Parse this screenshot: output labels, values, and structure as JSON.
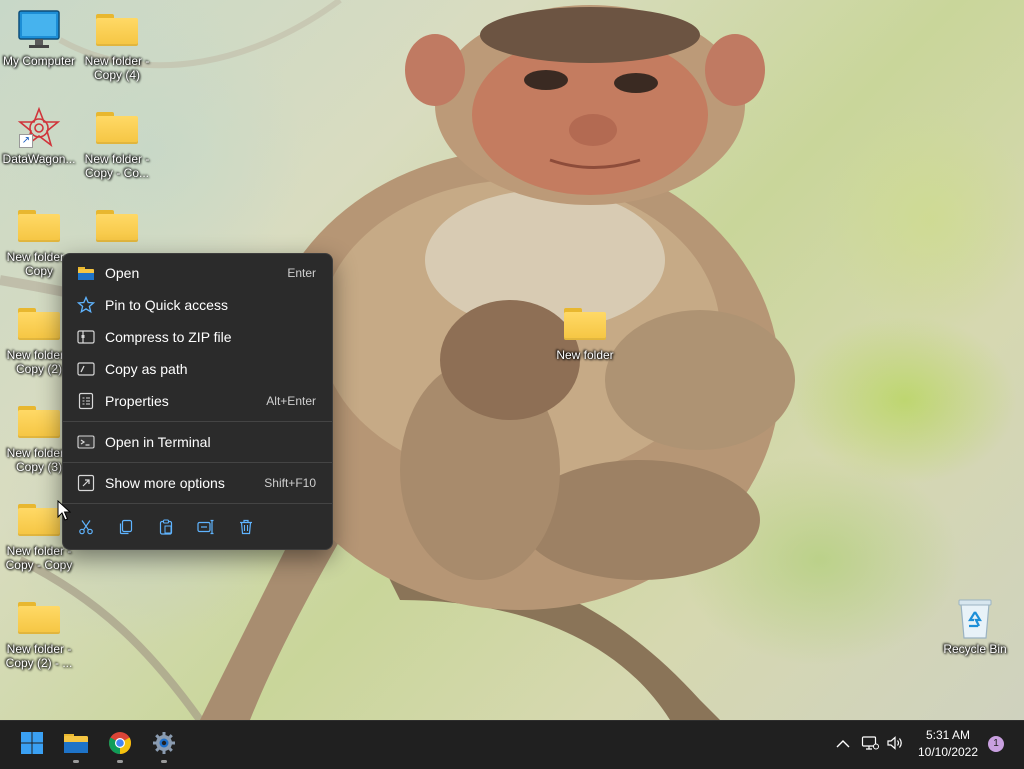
{
  "desktop": {
    "icons": [
      {
        "label": "My Computer",
        "icon": "monitor-icon"
      },
      {
        "label": "New folder - Copy (4)",
        "icon": "folder-icon"
      },
      {
        "label": "DataWagon...",
        "icon": "datawagon-shortcut-icon"
      },
      {
        "label": "New folder - Copy - Co...",
        "icon": "folder-icon"
      },
      {
        "label": "New folder - Copy",
        "icon": "folder-icon"
      },
      {
        "label": "",
        "icon": "folder-icon"
      },
      {
        "label": "New folder - Copy (2)",
        "icon": "folder-icon"
      },
      {
        "label": "New folder - Copy (3)",
        "icon": "folder-icon"
      },
      {
        "label": "New folder - Copy - Copy",
        "icon": "folder-icon"
      },
      {
        "label": "New folder - Copy (2) - ...",
        "icon": "folder-icon"
      },
      {
        "label": "New folder",
        "icon": "folder-icon"
      },
      {
        "label": "Recycle Bin",
        "icon": "recycle-bin-icon"
      }
    ]
  },
  "context_menu": {
    "items": [
      {
        "label": "Open",
        "shortcut": "Enter",
        "icon": "folder-open-icon"
      },
      {
        "label": "Pin to Quick access",
        "shortcut": "",
        "icon": "star-icon"
      },
      {
        "label": "Compress to ZIP file",
        "shortcut": "",
        "icon": "zip-icon"
      },
      {
        "label": "Copy as path",
        "shortcut": "",
        "icon": "path-icon"
      },
      {
        "label": "Properties",
        "shortcut": "Alt+Enter",
        "icon": "properties-icon"
      },
      {
        "label": "Open in Terminal",
        "shortcut": "",
        "icon": "terminal-icon"
      },
      {
        "label": "Show more options",
        "shortcut": "Shift+F10",
        "icon": "more-options-icon"
      }
    ],
    "actions": [
      "cut-icon",
      "copy-icon",
      "paste-icon",
      "rename-icon",
      "delete-icon"
    ]
  },
  "taskbar": {
    "apps": [
      "start-icon",
      "file-explorer-icon",
      "chrome-icon",
      "settings-icon"
    ],
    "tray": [
      "chevron-up-icon",
      "network-icon",
      "volume-icon"
    ],
    "time": "5:31 AM",
    "date": "10/10/2022",
    "notification_count": "1"
  },
  "colors": {
    "menu_bg": "#2b2b2b",
    "taskbar_bg": "#202020",
    "folder": "#f5c542",
    "accent": "#0078d4"
  }
}
